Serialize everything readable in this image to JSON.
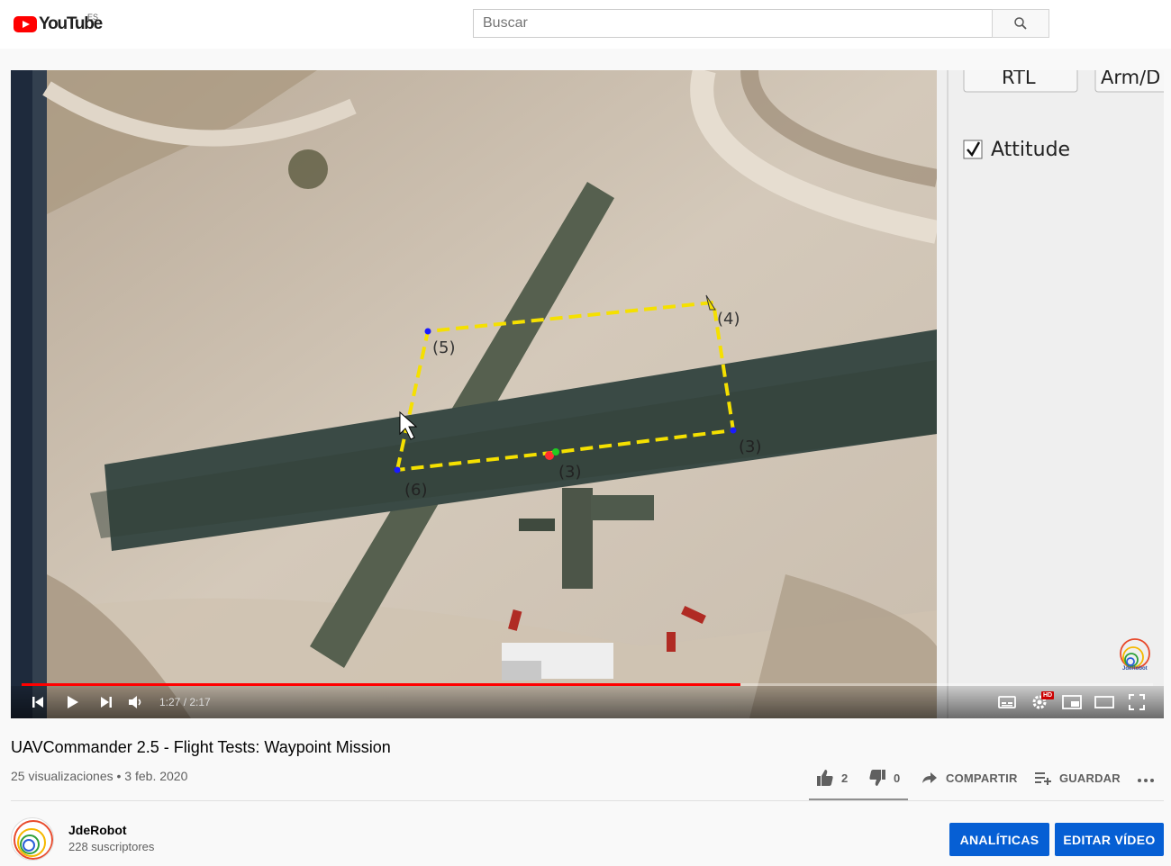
{
  "header": {
    "logo_text": "YouTube",
    "region": "ES",
    "search_placeholder": "Buscar"
  },
  "video_overlay": {
    "rtl_button": "RTL",
    "arm_button": "Arm/D",
    "attitude_label": "Attitude",
    "attitude_checked": true,
    "waypoints": [
      "(3)",
      "(4)",
      "(5)",
      "(6)",
      "(3)"
    ],
    "watermark": "JdeRobot"
  },
  "player": {
    "current_time": "1:27",
    "duration": "2:17",
    "time_display": "1:27 / 2:17",
    "progress_fraction": 0.635,
    "hd_badge": "HD"
  },
  "video": {
    "title": "UAVCommander 2.5 - Flight Tests: Waypoint Mission",
    "meta": "25 visualizaciones • 3 feb. 2020"
  },
  "actions": {
    "likes": "2",
    "dislikes": "0",
    "share_label": "COMPARTIR",
    "save_label": "GUARDAR",
    "more_label": "..."
  },
  "channel": {
    "name": "JdeRobot",
    "subscribers": "228 suscriptores",
    "analytics_button": "ANALÍTICAS",
    "edit_button": "EDITAR VÍDEO"
  },
  "colors": {
    "accent": "#065fd4",
    "progress": "#ff0000",
    "brand": "#ff0000",
    "waypoint_line": "#f5e000"
  }
}
